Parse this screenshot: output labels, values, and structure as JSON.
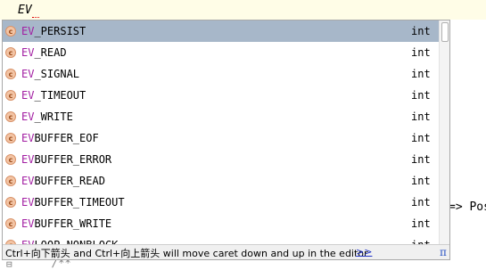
{
  "editor": {
    "typed_text": "EV",
    "right_fragment": "=> Pos",
    "bottom_fragment": "/**",
    "gutter_symbol": "⊟"
  },
  "completion": {
    "items": [
      {
        "match": "EV",
        "rest": "_PERSIST",
        "type": "int",
        "icon": "constant-icon",
        "icon_glyph": "c",
        "selected": true
      },
      {
        "match": "EV",
        "rest": "_READ",
        "type": "int",
        "icon": "constant-icon",
        "icon_glyph": "c"
      },
      {
        "match": "EV",
        "rest": "_SIGNAL",
        "type": "int",
        "icon": "constant-icon",
        "icon_glyph": "c"
      },
      {
        "match": "EV",
        "rest": "_TIMEOUT",
        "type": "int",
        "icon": "constant-icon",
        "icon_glyph": "c"
      },
      {
        "match": "EV",
        "rest": "_WRITE",
        "type": "int",
        "icon": "constant-icon",
        "icon_glyph": "c"
      },
      {
        "match": "EV",
        "rest": "BUFFER_EOF",
        "type": "int",
        "icon": "constant-icon",
        "icon_glyph": "c"
      },
      {
        "match": "EV",
        "rest": "BUFFER_ERROR",
        "type": "int",
        "icon": "constant-icon",
        "icon_glyph": "c"
      },
      {
        "match": "EV",
        "rest": "BUFFER_READ",
        "type": "int",
        "icon": "constant-icon",
        "icon_glyph": "c"
      },
      {
        "match": "EV",
        "rest": "BUFFER_TIMEOUT",
        "type": "int",
        "icon": "constant-icon",
        "icon_glyph": "c"
      },
      {
        "match": "EV",
        "rest": "BUFFER_WRITE",
        "type": "int",
        "icon": "constant-icon",
        "icon_glyph": "c"
      },
      {
        "match": "EV",
        "rest": "LOOP_NONBLOCK",
        "type": "int",
        "icon": "constant-icon",
        "icon_glyph": "c"
      }
    ],
    "hint_text": "Ctrl+向下箭头 and Ctrl+向上箭头 will move caret down and up in the editor",
    "hint_more": ">>",
    "pi_symbol": "π"
  },
  "colors": {
    "selection": "#a7b7c9",
    "match": "#a21ea2",
    "link": "#2234c7"
  }
}
